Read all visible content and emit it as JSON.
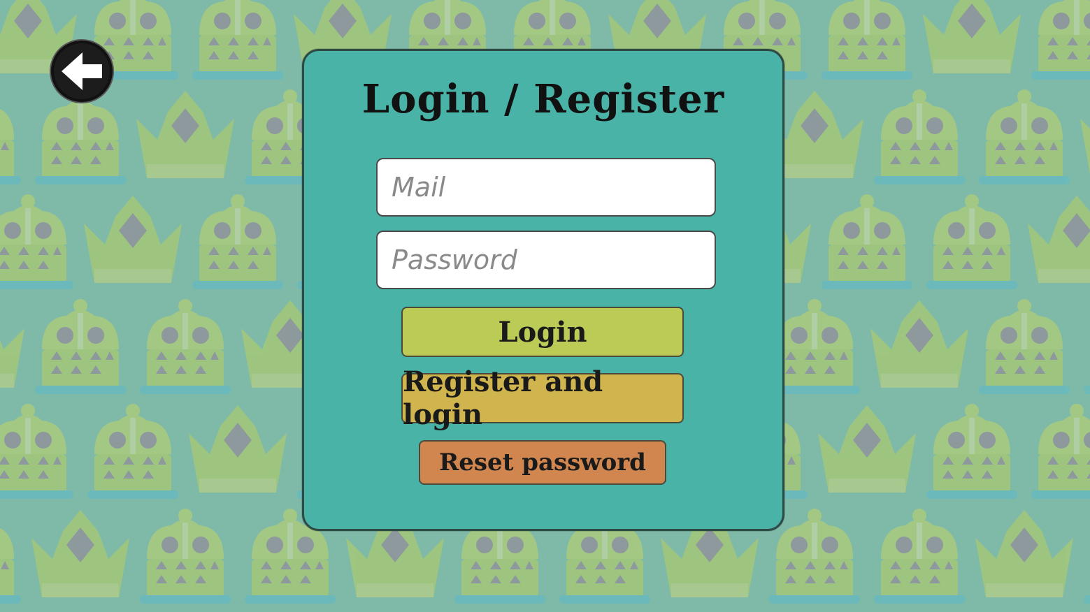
{
  "screen": {
    "title": "Login / Register"
  },
  "back": {
    "icon": "arrow-left-icon"
  },
  "form": {
    "mail_placeholder": "Mail",
    "password_placeholder": "Password",
    "login_label": "Login",
    "register_label": "Register and login",
    "reset_label": "Reset password"
  },
  "colors": {
    "background": "#7fbaa9",
    "panel": "#4ab3a8",
    "login_button": "#bccb55",
    "register_button": "#d0b44e",
    "reset_button": "#d1864f"
  }
}
